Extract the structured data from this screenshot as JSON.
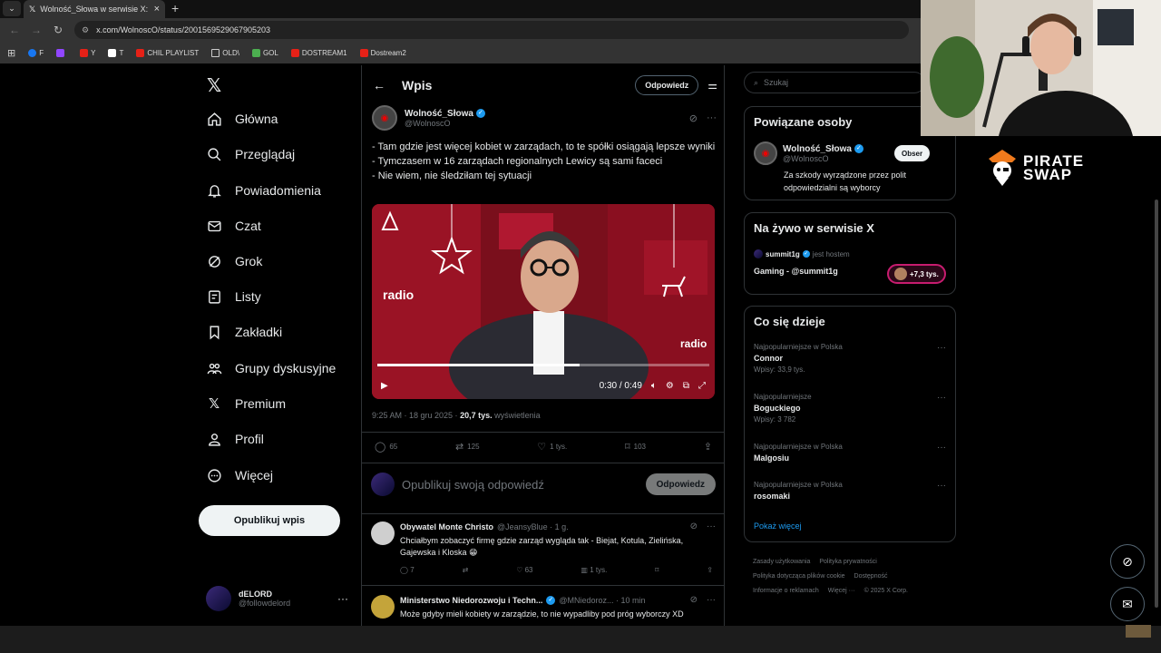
{
  "browser": {
    "tab_title": "Wolność_Słowa w serwisie X: ",
    "url": "x.com/WolnoscO/status/2001569529067905203",
    "bookmarks": [
      {
        "label": "F",
        "icon": "facebook-icon"
      },
      {
        "label": "",
        "icon": "twitch-icon"
      },
      {
        "label": "Y",
        "icon": "youtube-icon"
      },
      {
        "label": "T",
        "icon": "x-icon"
      },
      {
        "label": "CHIL PLAYLIST",
        "icon": "youtube-icon"
      },
      {
        "label": "OLD\\",
        "icon": "folder-icon"
      },
      {
        "label": "GOL",
        "icon": "gol-icon"
      },
      {
        "label": "DOSTREAM1",
        "icon": "youtube-icon"
      },
      {
        "label": "Dostream2",
        "icon": "youtube-icon"
      }
    ]
  },
  "nav": {
    "items": [
      {
        "label": "Główna",
        "icon": "home-icon"
      },
      {
        "label": "Przeglądaj",
        "icon": "search-icon"
      },
      {
        "label": "Powiadomienia",
        "icon": "bell-icon"
      },
      {
        "label": "Czat",
        "icon": "mail-icon"
      },
      {
        "label": "Grok",
        "icon": "grok-icon"
      },
      {
        "label": "Listy",
        "icon": "list-icon"
      },
      {
        "label": "Zakładki",
        "icon": "bookmark-icon"
      },
      {
        "label": "Grupy dyskusyjne",
        "icon": "communities-icon"
      },
      {
        "label": "Premium",
        "icon": "x-premium-icon"
      },
      {
        "label": "Profil",
        "icon": "person-icon"
      },
      {
        "label": "Więcej",
        "icon": "more-circle-icon"
      }
    ],
    "post_button": "Opublikuj wpis",
    "user": {
      "name": "dELORD",
      "handle": "@followdelord"
    }
  },
  "main": {
    "title": "Wpis",
    "reply_label": "Odpowiedz",
    "tweet": {
      "author": "Wolność_Słowa",
      "handle": "@WolnoscO",
      "text": "- Tam gdzie jest więcej kobiet w zarządach, to te spółki osiągają lepsze wyniki\n- Tymczasem w 16 zarządach regionalnych Lewicy są sami faceci\n- Nie wiem, nie śledziłam tej sytuacji",
      "video_time": "0:30 / 0:49",
      "video_progress": 0.61,
      "timestamp": "9:25 AM · 18 gru 2025 · ",
      "views": "20,7 tys.",
      "views_label": "wyświetlenia",
      "replies": "65",
      "reposts": "125",
      "likes": "1 tys.",
      "bookmarks": "103"
    },
    "composer": {
      "placeholder": "Opublikuj swoją odpowiedź",
      "button": "Odpowiedz"
    },
    "replies": [
      {
        "name": "Obywatel Monte Christo",
        "handle": "@JeansyBlue · 1 g.",
        "text": "Chciałbym zobaczyć firmę gdzie zarząd wygląda tak - Biejat, Kotula, Zielińska, Gajewska i Kloska 😁",
        "replies": "7",
        "reposts": "",
        "likes": "63",
        "views": "1 tys."
      },
      {
        "name": "Ministerstwo Niedorozwoju i Techn...",
        "handle": "@MNiedoroz... · 10 min",
        "text": "Może gdyby mieli kobiety w zarządzie, to nie wypadliby pod próg wyborczy XD"
      }
    ]
  },
  "right": {
    "search_placeholder": "Szukaj",
    "related": {
      "title": "Powiązane osoby",
      "name": "Wolność_Słowa",
      "handle": "@WolnoscO",
      "follow": "Obser",
      "bio": "Za szkody wyrządzone przez polit odpowiedzialni są wyborcy"
    },
    "live": {
      "title": "Na żywo w serwisie X",
      "host": "summit1g",
      "host_label": "jest hostem",
      "stream": "Gaming - @summit1g",
      "listeners": "+7,3 tys."
    },
    "trends": {
      "title": "Co się dzieje",
      "items": [
        {
          "context": "Najpopularniejsze w Polska",
          "name": "Connor",
          "posts": "Wpisy: 33,9 tys."
        },
        {
          "context": "Najpopularniejsze",
          "name": "Boguckiego",
          "posts": "Wpisy: 3 782"
        },
        {
          "context": "Najpopularniejsze w Polska",
          "name": "Malgosiu",
          "posts": ""
        },
        {
          "context": "Najpopularniejsze w Polska",
          "name": "rosomaki",
          "posts": ""
        }
      ],
      "show_more": "Pokaż więcej"
    },
    "footer": [
      "Zasady użytkowania",
      "Polityka prywatności",
      "Polityka dotycząca plików cookie",
      "Dostępność",
      "Informacje o reklamach",
      "Więcej ···",
      "© 2025 X Corp."
    ]
  },
  "overlay": {
    "sponsor_line1": "PIRATE",
    "sponsor_line2": "SWAP"
  }
}
